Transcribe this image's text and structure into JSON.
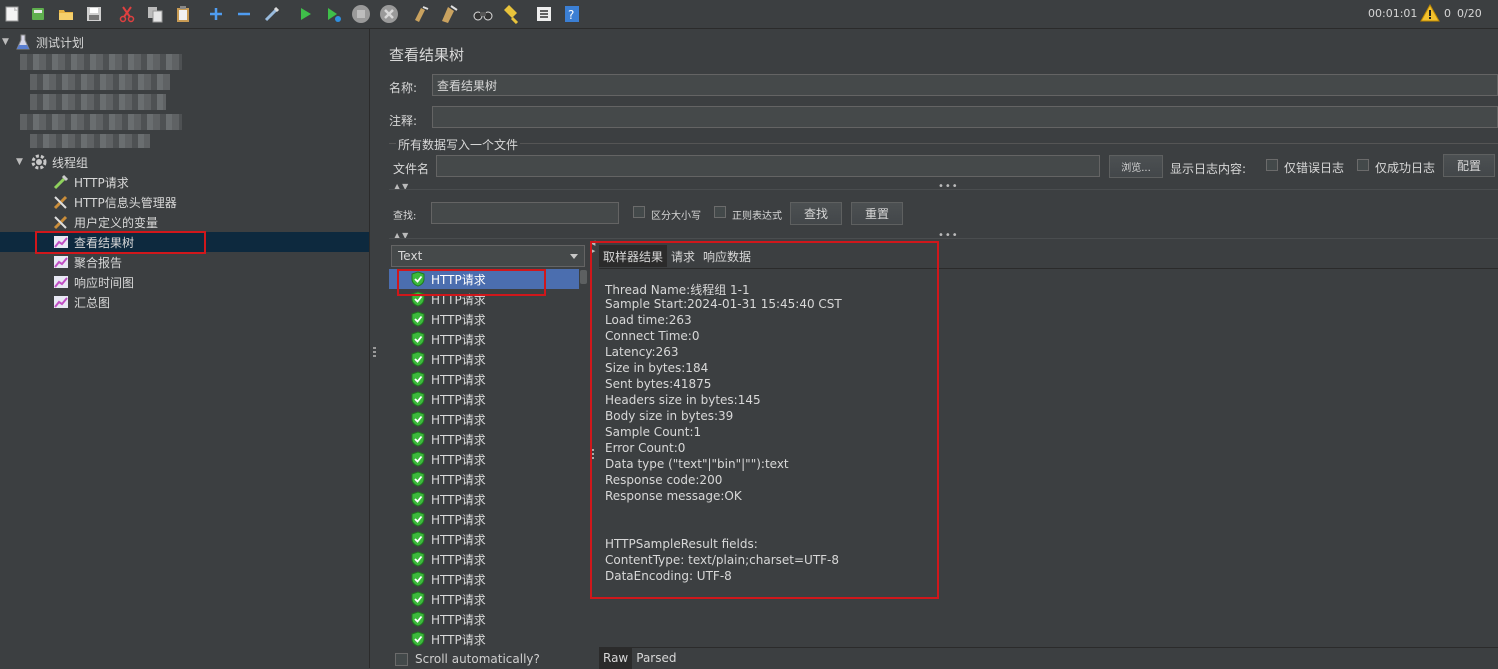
{
  "toolbar": {
    "buttons": [
      "new-icon",
      "templates-icon",
      "open-icon",
      "save-icon",
      "cut-icon",
      "copy-icon",
      "paste-icon",
      "expand-icon",
      "collapse-icon",
      "toggle-icon",
      "start-icon",
      "start-no-pause-icon",
      "stop-icon",
      "shutdown-icon",
      "clear-icon",
      "clear-all-icon",
      "search-icon",
      "reset-search-icon",
      "function-helper-icon",
      "help-icon"
    ],
    "timer": "00:01:01",
    "warning_count": "0",
    "thread_count": "0/20"
  },
  "tree": {
    "test_plan": "测试计划",
    "thread_group": "线程组",
    "children": [
      {
        "label": "HTTP请求",
        "icon": "sampler-icon"
      },
      {
        "label": "HTTP信息头管理器",
        "icon": "config-icon"
      },
      {
        "label": "用户定义的变量",
        "icon": "config-icon"
      },
      {
        "label": "查看结果树",
        "icon": "listener-icon"
      },
      {
        "label": "聚合报告",
        "icon": "listener-icon"
      },
      {
        "label": "响应时间图",
        "icon": "listener-icon"
      },
      {
        "label": "汇总图",
        "icon": "listener-icon"
      }
    ]
  },
  "main": {
    "title": "查看结果树",
    "name_label": "名称:",
    "name_value": "查看结果树",
    "comment_label": "注释:",
    "comment_value": "",
    "file_section_label": "所有数据写入一个文件",
    "filename_label": "文件名",
    "filename_value": "",
    "browse_button": "浏览...",
    "log_content_label": "显示日志内容:",
    "errors_only_label": "仅错误日志",
    "success_only_label": "仅成功日志",
    "configure_button": "配置",
    "search_label": "查找:",
    "search_value": "",
    "case_sensitive_label": "区分大小写",
    "regex_label": "正则表达式",
    "find_button": "查找",
    "reset_button": "重置"
  },
  "results": {
    "renderer": "Text",
    "items": [
      "HTTP请求",
      "HTTP请求",
      "HTTP请求",
      "HTTP请求",
      "HTTP请求",
      "HTTP请求",
      "HTTP请求",
      "HTTP请求",
      "HTTP请求",
      "HTTP请求",
      "HTTP请求",
      "HTTP请求",
      "HTTP请求",
      "HTTP请求",
      "HTTP请求",
      "HTTP请求",
      "HTTP请求",
      "HTTP请求",
      "HTTP请求"
    ],
    "scroll_auto_label": "Scroll automatically?"
  },
  "detail": {
    "tabs": [
      "取样器结果",
      "请求",
      "响应数据"
    ],
    "lines": [
      "Thread Name:线程组 1-1",
      "Sample Start:2024-01-31 15:45:40 CST",
      "Load time:263",
      "Connect Time:0",
      "Latency:263",
      "Size in bytes:184",
      "Sent bytes:41875",
      "Headers size in bytes:145",
      "Body size in bytes:39",
      "Sample Count:1",
      "Error Count:0",
      "Data type (\"text\"|\"bin\"|\"\"):text",
      "Response code:200",
      "Response message:OK",
      "",
      "",
      "HTTPSampleResult fields:",
      "ContentType: text/plain;charset=UTF-8",
      "DataEncoding: UTF-8"
    ],
    "bottom_tabs": [
      "Raw",
      "Parsed"
    ]
  }
}
